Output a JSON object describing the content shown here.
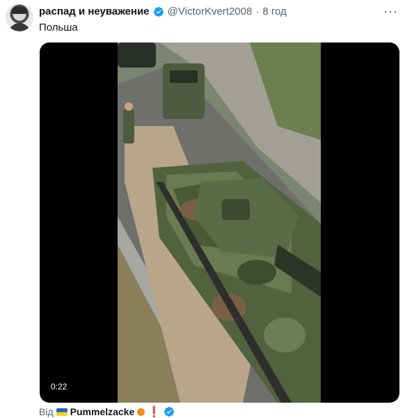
{
  "tweet": {
    "display_name": "распад и неуважение",
    "handle": "@VictorKvert2008",
    "separator": "·",
    "time": "8 год",
    "text": "Польша",
    "more_label": "···",
    "verified_icon": "verified-badge-icon"
  },
  "media": {
    "timestamp": "0:22",
    "content": "video-frame-tanks-on-trailer"
  },
  "footer": {
    "prefix": "Від",
    "user": "Pummelzacke",
    "emoji_1": "ukraine-flag-icon",
    "emoji_2": "orange-icon",
    "emoji_3": "exclamation-icon",
    "exclamation_text": "❗",
    "verified_icon": "verified-badge-icon"
  },
  "colors": {
    "verified_blue": "#1d9bf0",
    "secondary_text": "#536471",
    "primary_text": "#0f1419"
  }
}
